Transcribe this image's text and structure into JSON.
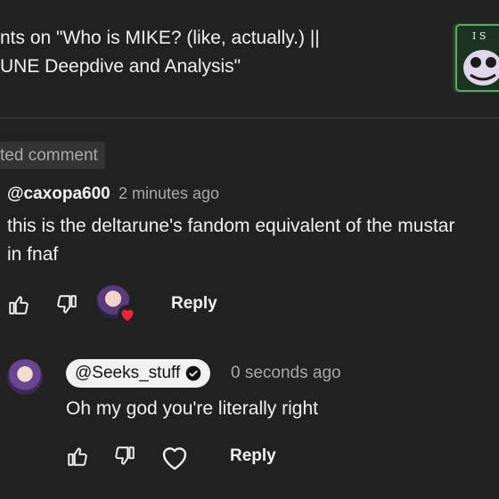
{
  "header": {
    "title_line1": "nts on \"Who is MIKE? (like, actually.) ||",
    "title_line2": "UNE Deepdive and Analysis\"",
    "thumbnail_icon": "video-thumbnail"
  },
  "highlight": {
    "label": "ted comment"
  },
  "comment": {
    "author": "@caxopa600",
    "time": "2 minutes ago",
    "text_line1": "this is the deltarune's fandom equivalent of the mustar",
    "text_line2": "in fnaf",
    "reply_label": "Reply",
    "icons": [
      "thumbs-up-icon",
      "thumbs-down-icon",
      "creator-heart-icon"
    ]
  },
  "reply": {
    "author": "@Seeks_stuff",
    "time": "0 seconds ago",
    "text": "Oh my god you're literally right",
    "reply_label": "Reply",
    "icons": [
      "thumbs-up-icon",
      "thumbs-down-icon",
      "heart-icon",
      "verified-icon"
    ]
  },
  "colors": {
    "background": "#212121",
    "text": "#f1f1f1",
    "muted": "#aaaaaa",
    "heart": "#e5273f",
    "chip": "#333333"
  }
}
